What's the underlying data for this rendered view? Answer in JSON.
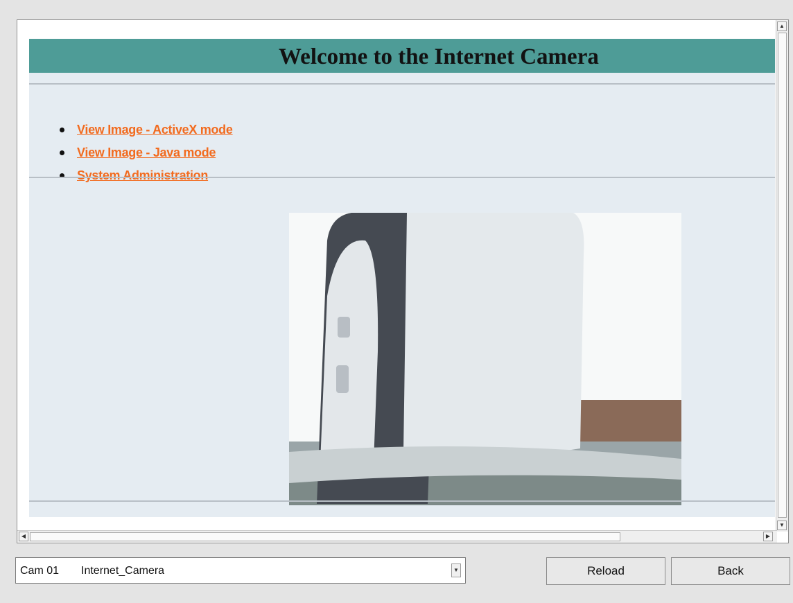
{
  "page": {
    "banner_title": "Welcome to the Internet Camera",
    "links": [
      {
        "label": "View Image - ActiveX mode"
      },
      {
        "label": "View Image - Java mode"
      },
      {
        "label": "System Administration"
      }
    ]
  },
  "bottom_bar": {
    "camera_select": {
      "cam_id": "Cam 01",
      "cam_name": "Internet_Camera"
    },
    "reload_label": "Reload",
    "back_label": "Back"
  },
  "colors": {
    "banner": "#4e9c97",
    "link": "#f26b1f",
    "panel": "#e5ecf2"
  },
  "icons": {
    "scroll_up": "triangle-up-icon",
    "scroll_down": "triangle-down-icon",
    "scroll_left": "triangle-left-icon",
    "scroll_right": "triangle-right-icon",
    "dropdown": "chevron-down-icon"
  }
}
